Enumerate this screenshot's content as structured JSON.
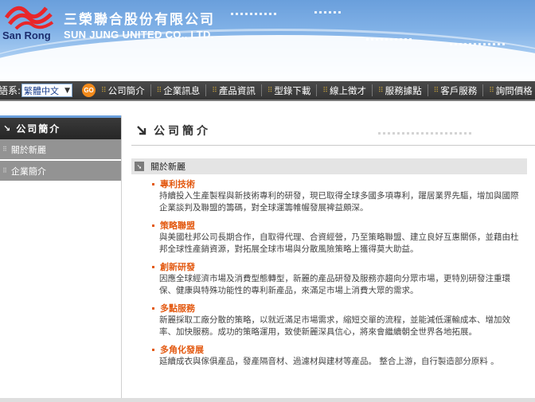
{
  "header": {
    "logo_text": "San Rong",
    "company_zh": "三榮聯合股份有限公司",
    "company_en": "SUN JUNG UNITED CO., LTD."
  },
  "nav": {
    "lang_label": "語系:",
    "lang_value": "繁體中文",
    "go_label": "GO",
    "items": [
      "公司簡介",
      "企業訊息",
      "產品資訊",
      "型錄下載",
      "線上徵才",
      "服務據點",
      "客戶服務",
      "詢問價格"
    ]
  },
  "sidebar": {
    "title": "公司簡介",
    "items": [
      "關於新麗",
      "企業簡介"
    ]
  },
  "main": {
    "page_title": "公司簡介",
    "section_title": "關於新麗",
    "items": [
      {
        "title": "專利技術",
        "lines": [
          "持續投入生產製程與新技術專利的研發，現已取得全球多國多項專利，躍居業界先驅，增加與國際",
          "企業談判及聯盟的籌碼，對全球運籌帷幄發展裨益頗深。"
        ]
      },
      {
        "title": "策略聯盟",
        "lines": [
          "與美國杜邦公司長期合作，自取得代理、合資經營，乃至策略聯盟、建立良好互惠關係，並藉由杜",
          "邦全球性產銷資源，對拓展全球市場與分散風險策略上獲得莫大助益。"
        ]
      },
      {
        "title": "創新研發",
        "lines": [
          "因應全球經濟市場及消費型態轉型，新麗的產品研發及服務亦趨向分眾市場，更特別研發注重環",
          "保、健康與特殊功能性的專利新產品，來滿足市場上消費大眾的需求。"
        ]
      },
      {
        "title": "多點服務",
        "lines": [
          "新麗採取工廠分散的策略，以就近滿足市場需求，縮短交單的流程，並能減低運輸成本、增加效",
          "率、加快服務。成功的策略運用，致使新麗深具信心，將來會繼續朝全世界各地拓展。"
        ]
      },
      {
        "title": "多角化發展",
        "lines": [
          "延續成衣與傢俱產品，發產隔音材、過濾材與建材等產品。 整合上游，自行製造部分原料 。"
        ]
      }
    ]
  },
  "colors": {
    "accent_orange": "#e35a12",
    "header_blue": "#6a9fdc",
    "nav_dark": "#3a3a3a"
  }
}
